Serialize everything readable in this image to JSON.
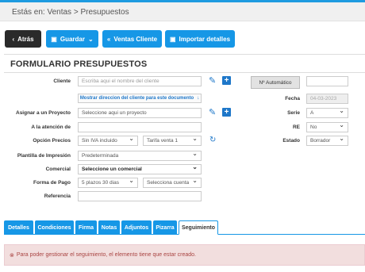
{
  "breadcrumb": {
    "text": "Estás en: Ventas > Presupuestos"
  },
  "toolbar": {
    "back_label": "Atrás",
    "save_label": "Guardar",
    "sales_client_label": "Ventas Cliente",
    "import_details_label": "Importar detalles"
  },
  "form": {
    "title": "FORMULARIO PRESUPUESTOS",
    "labels": {
      "cliente": "Cliente",
      "asignar_proyecto": "Asignar a un Proyecto",
      "atencion": "A la atención de",
      "opcion_precios": "Opción Precios",
      "plantilla": "Plantilla de Impresión",
      "comercial": "Comercial",
      "forma_pago": "Forma de Pago",
      "referencia": "Referencia",
      "fecha": "Fecha",
      "serie": "Serie",
      "re": "RE",
      "estado": "Estado"
    },
    "cliente_placeholder": "Escriba aqui el nombre del cliente",
    "direccion_link": "Mostrar direccion del cliente para este documento",
    "proyecto_placeholder": "Seleccione aqui un proyecto",
    "atencion_value": "",
    "iva_value": "Sin IVA incluido",
    "tarifa_value": "Tarifa venta 1",
    "plantilla_value": "Predeterminada",
    "comercial_value": "Seleccione un comercial",
    "forma_pago_value": "5 plazos 30 dias",
    "cuenta_value": "Selecciona cuenta",
    "referencia_value": "",
    "numero_label": "Nº Automático",
    "numero_extra": "",
    "fecha_value": "04-03-2023",
    "serie_value": "A",
    "re_value": "No",
    "estado_value": "Borrador"
  },
  "tabs": [
    {
      "label": "Detalles"
    },
    {
      "label": "Condiciones"
    },
    {
      "label": "Firma"
    },
    {
      "label": "Notas"
    },
    {
      "label": "Adjuntos"
    },
    {
      "label": "Pizarra"
    },
    {
      "label": "Seguimiento"
    }
  ],
  "alert": {
    "text": "Para poder gestionar el seguimiento, el elemento tiene que estar creado."
  },
  "colors": {
    "accent": "#1697e6",
    "dark_button": "#2a2a2a",
    "alert_bg": "#f2dede",
    "alert_text": "#a94442"
  }
}
